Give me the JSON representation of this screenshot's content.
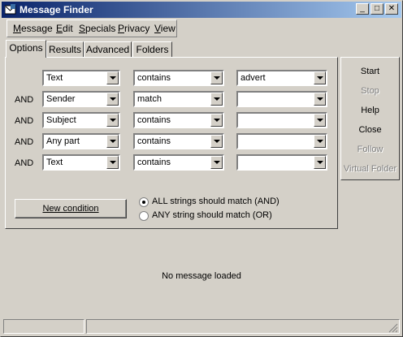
{
  "window": {
    "title": "Message Finder"
  },
  "menu": [
    {
      "label": "Message",
      "accel": "M",
      "rest": "essage"
    },
    {
      "label": "Edit",
      "accel": "E",
      "rest": "dit"
    },
    {
      "label": "Specials",
      "accel": "S",
      "rest": "pecials"
    },
    {
      "label": "Privacy",
      "accel": "P",
      "rest": "rivacy"
    },
    {
      "label": "View",
      "accel": "V",
      "rest": "iew"
    }
  ],
  "tabs": [
    "Options",
    "Results",
    "Advanced",
    "Folders"
  ],
  "conditions": [
    {
      "op": "",
      "field": "Text",
      "match": "contains",
      "value": "advert"
    },
    {
      "op": "AND",
      "field": "Sender",
      "match": "match",
      "value": ""
    },
    {
      "op": "AND",
      "field": "Subject",
      "match": "contains",
      "value": ""
    },
    {
      "op": "AND",
      "field": "Any part",
      "match": "contains",
      "value": ""
    },
    {
      "op": "AND",
      "field": "Text",
      "match": "contains",
      "value": ""
    }
  ],
  "new_condition": {
    "label": "New condition"
  },
  "match_mode": {
    "options": [
      "ALL strings should match (AND)",
      "ANY string should match (OR)"
    ],
    "selected": 0
  },
  "side_buttons": [
    {
      "label": "Start",
      "enabled": true
    },
    {
      "label": "Stop",
      "enabled": false
    },
    {
      "label": "Help",
      "enabled": true
    },
    {
      "label": "Close",
      "enabled": true
    },
    {
      "label": "Follow",
      "enabled": false
    },
    {
      "label": "Virtual Folder",
      "enabled": false
    }
  ],
  "status_message": "No message loaded"
}
